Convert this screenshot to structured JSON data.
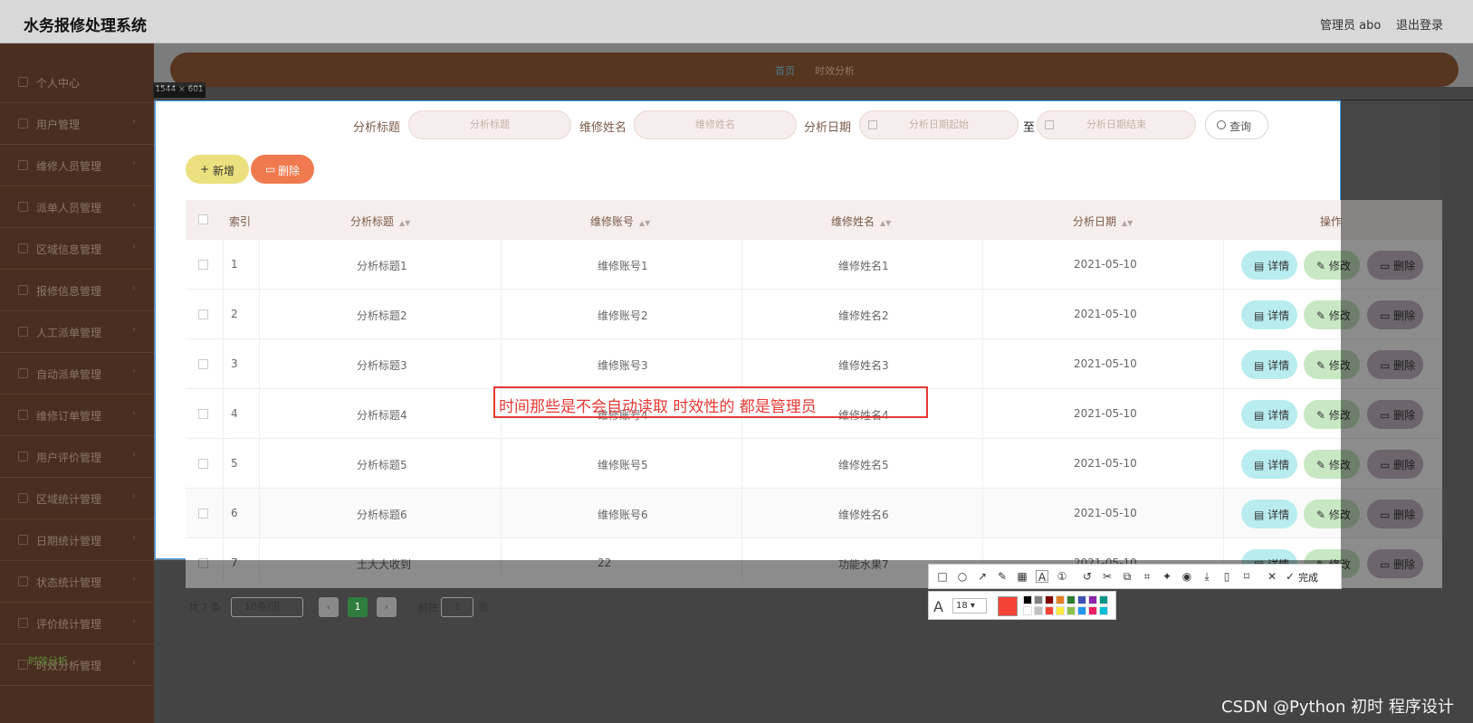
{
  "app": {
    "title": "水务报修处理系统",
    "user": "管理员 abo",
    "logout": "退出登录"
  },
  "sidebar": {
    "items": [
      {
        "label": "个人中心"
      },
      {
        "label": "用户管理"
      },
      {
        "label": "维修人员管理"
      },
      {
        "label": "派单人员管理"
      },
      {
        "label": "区域信息管理"
      },
      {
        "label": "报修信息管理"
      },
      {
        "label": "人工派单管理"
      },
      {
        "label": "自动派单管理"
      },
      {
        "label": "维修订单管理"
      },
      {
        "label": "用户评价管理"
      },
      {
        "label": "区域统计管理"
      },
      {
        "label": "日期统计管理"
      },
      {
        "label": "状态统计管理"
      },
      {
        "label": "评价统计管理"
      },
      {
        "label": "时效分析管理"
      }
    ],
    "active_sub": "时效分析"
  },
  "breadcrumb": {
    "home": "首页",
    "current": "时效分析"
  },
  "capture_size": "1544 × 601",
  "search": {
    "title_label": "分析标题",
    "title_placeholder": "分析标题",
    "name_label": "维修姓名",
    "name_placeholder": "维修姓名",
    "date_label": "分析日期",
    "date_start_placeholder": "分析日期起始",
    "date_to": "至",
    "date_end_placeholder": "分析日期结束",
    "query": "查询"
  },
  "actions": {
    "add": "新增",
    "delete": "删除"
  },
  "table": {
    "headers": [
      "索引",
      "分析标题",
      "维修账号",
      "维修姓名",
      "分析日期",
      "操作"
    ],
    "rows": [
      {
        "index": "1",
        "title": "分析标题1",
        "account": "维修账号1",
        "name": "维修姓名1",
        "date": "2021-05-10"
      },
      {
        "index": "2",
        "title": "分析标题2",
        "account": "维修账号2",
        "name": "维修姓名2",
        "date": "2021-05-10"
      },
      {
        "index": "3",
        "title": "分析标题3",
        "account": "维修账号3",
        "name": "维修姓名3",
        "date": "2021-05-10"
      },
      {
        "index": "4",
        "title": "分析标题4",
        "account": "维修账号4",
        "name": "维修姓名4",
        "date": "2021-05-10"
      },
      {
        "index": "5",
        "title": "分析标题5",
        "account": "维修账号5",
        "name": "维修姓名5",
        "date": "2021-05-10"
      },
      {
        "index": "6",
        "title": "分析标题6",
        "account": "维修账号6",
        "name": "维修姓名6",
        "date": "2021-05-10"
      },
      {
        "index": "7",
        "title": "土大大收到",
        "account": "22",
        "name": "功能水果7",
        "date": "2021-05-10"
      }
    ],
    "op_detail": "详情",
    "op_edit": "修改",
    "op_delete": "删除"
  },
  "annotation": "时间那些是不会自动读取 时效性的 都是管理员",
  "pagination": {
    "total": "共 7 条",
    "page_size": "10条/页",
    "current": "1",
    "goto": "前往",
    "goto_value": "1",
    "page_unit": "页"
  },
  "toolbar": {
    "done": "完成",
    "font_size": "18"
  },
  "colors": {
    "accent": "#4a2f20",
    "annotation": "#e53935"
  },
  "watermark": "CSDN @Python 初时 程序设计"
}
